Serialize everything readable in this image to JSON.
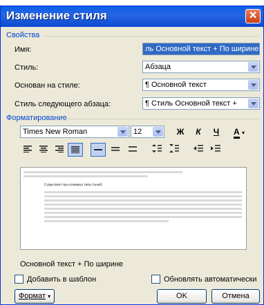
{
  "title": "Изменение стиля",
  "properties": {
    "section": "Свойства",
    "name_label": "Имя:",
    "name_value": "ль Основной текст + По ширине",
    "style_label": "Стиль:",
    "style_value": "Абзаца",
    "based_on_label": "Основан на стиле:",
    "based_on_value": "¶ Основной текст",
    "next_label": "Стиль следующего абзаца:",
    "next_value": "¶ Стиль Основной текст +"
  },
  "formatting": {
    "section": "Форматирование",
    "font": "Times New Roman",
    "size": "12",
    "bold": "Ж",
    "italic": "К",
    "underline": "Ч",
    "font_color": "А"
  },
  "preview": {
    "sample_text": "Существует три основных типа стилей."
  },
  "description": "Основной текст + По ширине",
  "options": {
    "add_to_template": "Добавить в шаблон",
    "auto_update": "Обновлять автоматически"
  },
  "buttons": {
    "format": "Формат",
    "ok": "OK",
    "cancel": "Отмена"
  }
}
